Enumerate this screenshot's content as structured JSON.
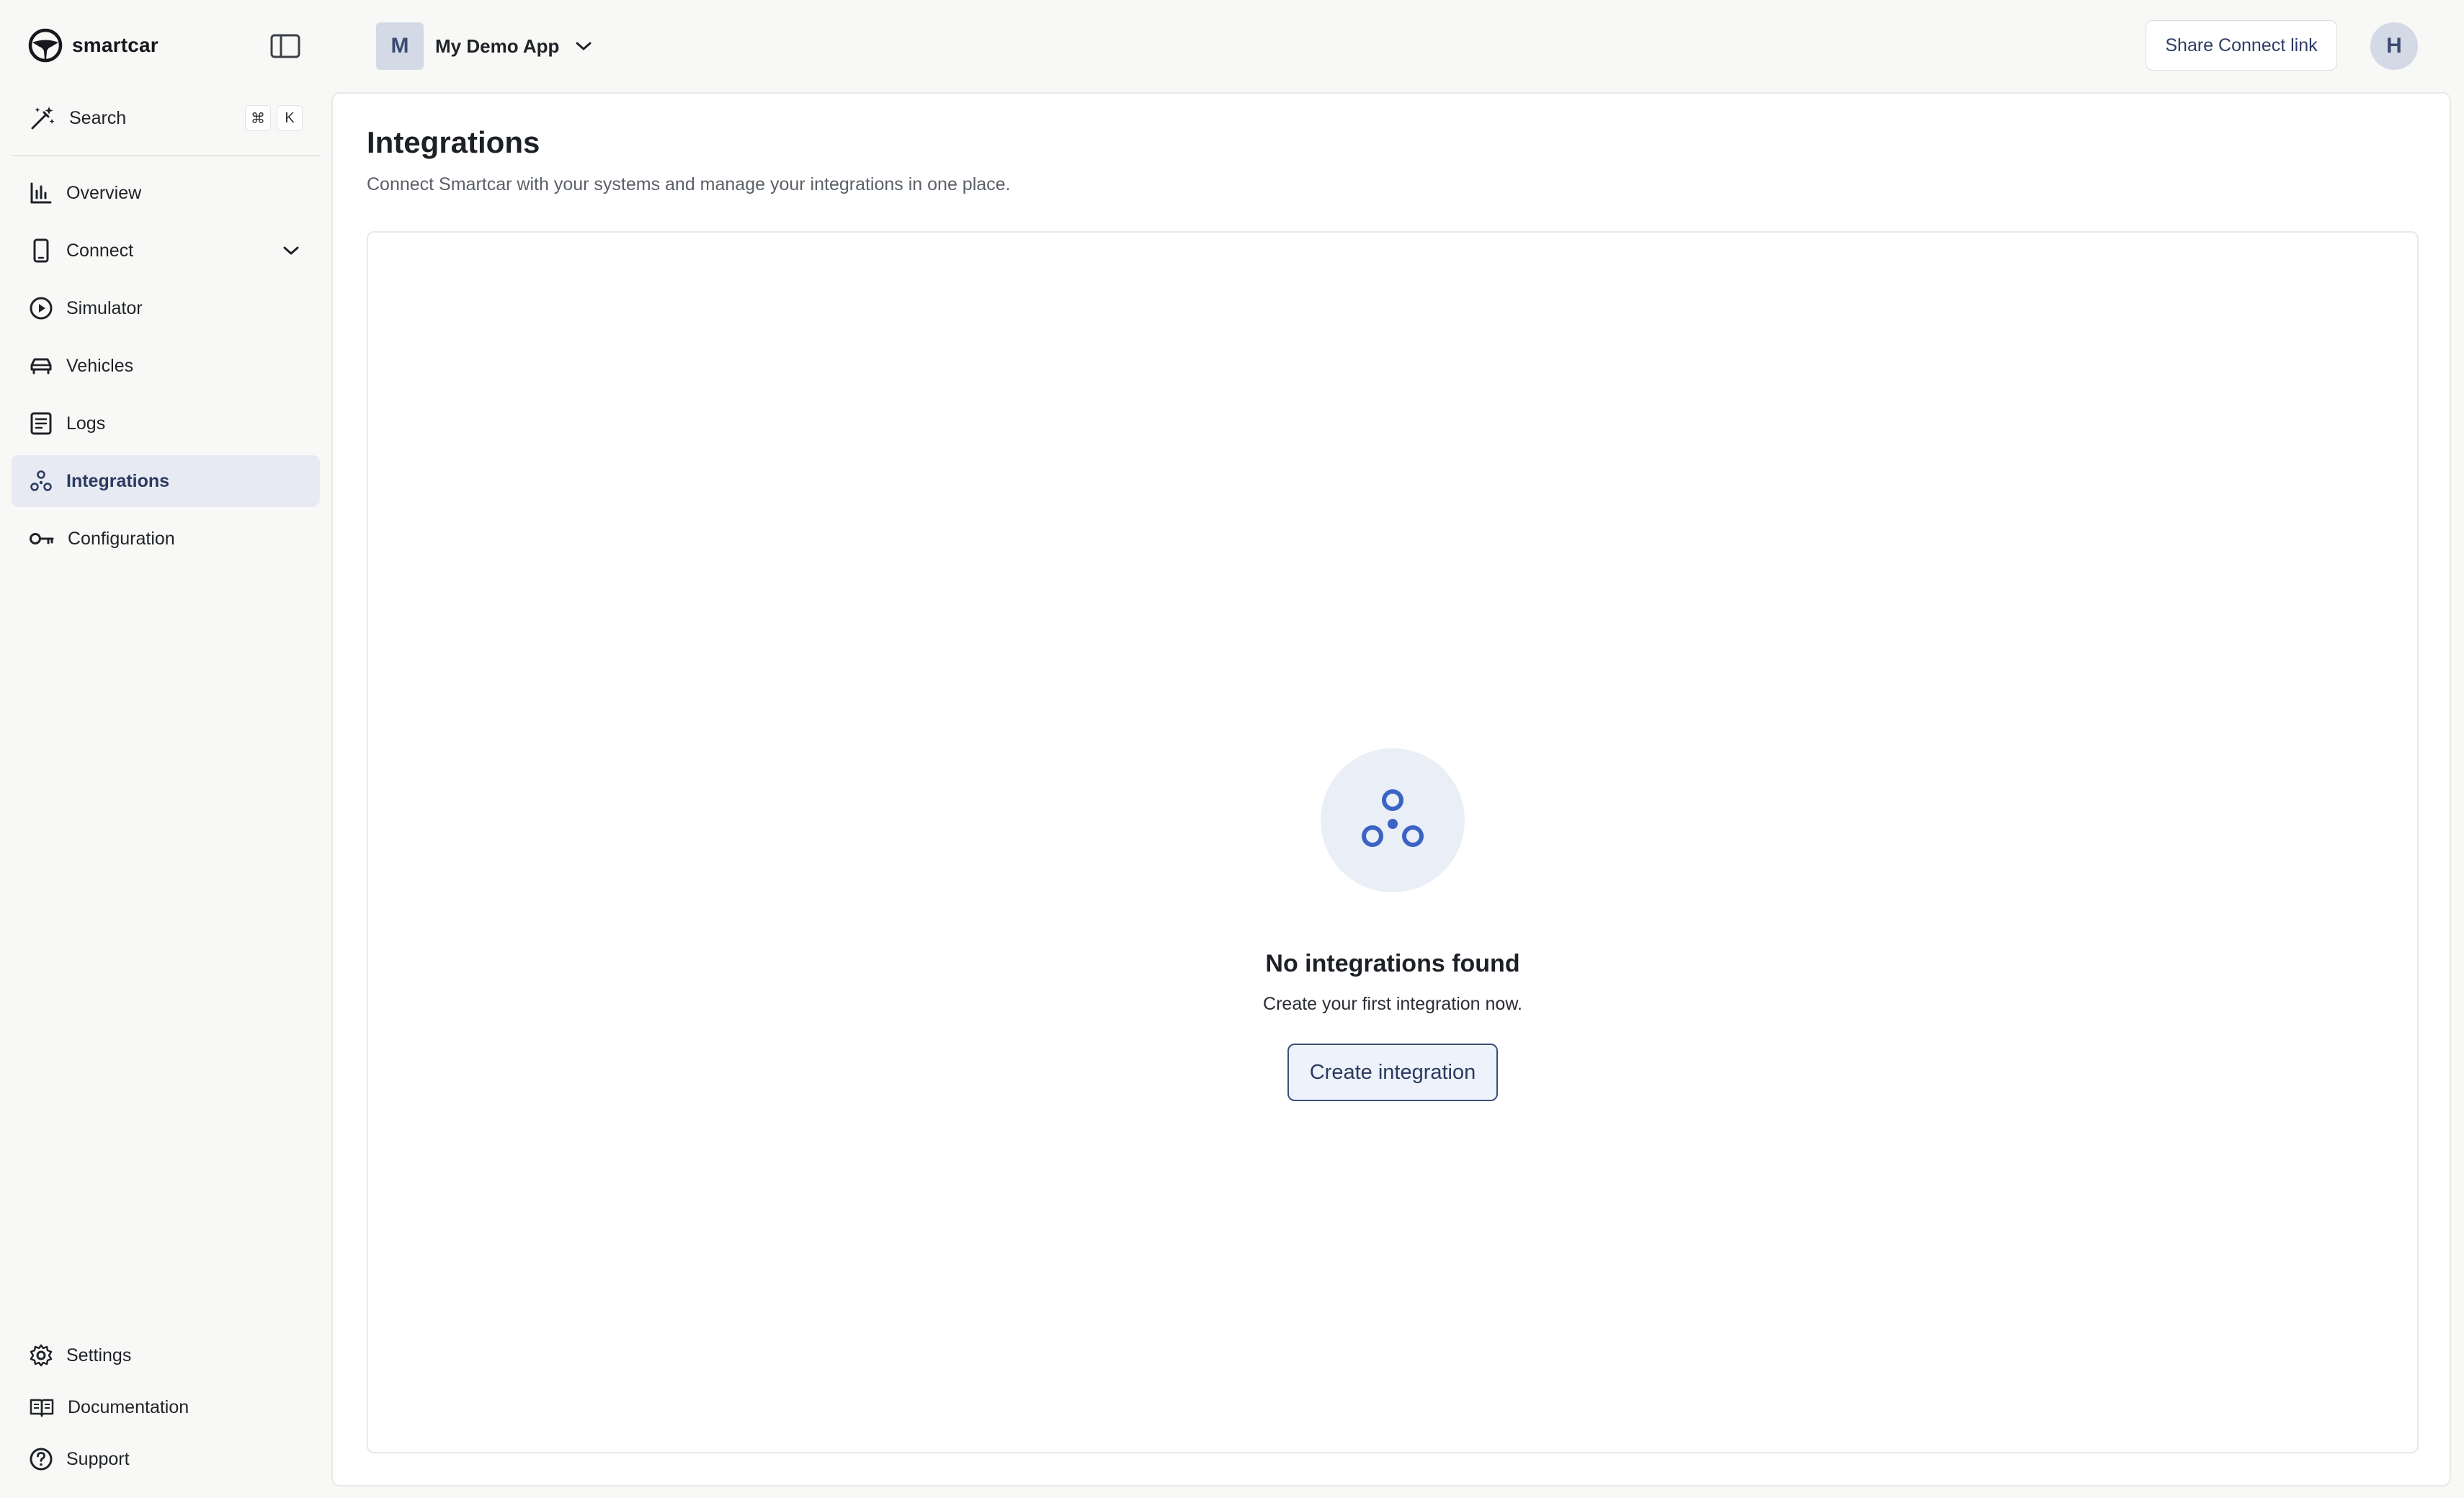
{
  "brand": {
    "name": "smartcar"
  },
  "search": {
    "label": "Search",
    "shortcut_keys": [
      "⌘",
      "K"
    ]
  },
  "sidebar": {
    "items": [
      {
        "label": "Overview",
        "icon": "bar-chart-icon"
      },
      {
        "label": "Connect",
        "icon": "phone-icon"
      },
      {
        "label": "Simulator",
        "icon": "play-circle-icon"
      },
      {
        "label": "Vehicles",
        "icon": "car-icon"
      },
      {
        "label": "Logs",
        "icon": "document-icon"
      },
      {
        "label": "Integrations",
        "icon": "integrations-icon",
        "active": true
      },
      {
        "label": "Configuration",
        "icon": "key-icon"
      }
    ],
    "bottom_items": [
      {
        "label": "Settings",
        "icon": "gear-icon"
      },
      {
        "label": "Documentation",
        "icon": "book-icon"
      },
      {
        "label": "Support",
        "icon": "help-circle-icon"
      }
    ]
  },
  "header": {
    "app_initial": "M",
    "app_name": "My Demo App",
    "share_button": "Share Connect link",
    "user_initial": "H"
  },
  "page": {
    "title": "Integrations",
    "subtitle": "Connect Smartcar with your systems and manage your integrations in one place."
  },
  "empty_state": {
    "title": "No integrations found",
    "description": "Create your first integration now.",
    "button": "Create integration"
  },
  "colors": {
    "accent": "#3a63c4",
    "active_nav_bg": "#e7eaf2",
    "button_border": "#3b4e78"
  }
}
